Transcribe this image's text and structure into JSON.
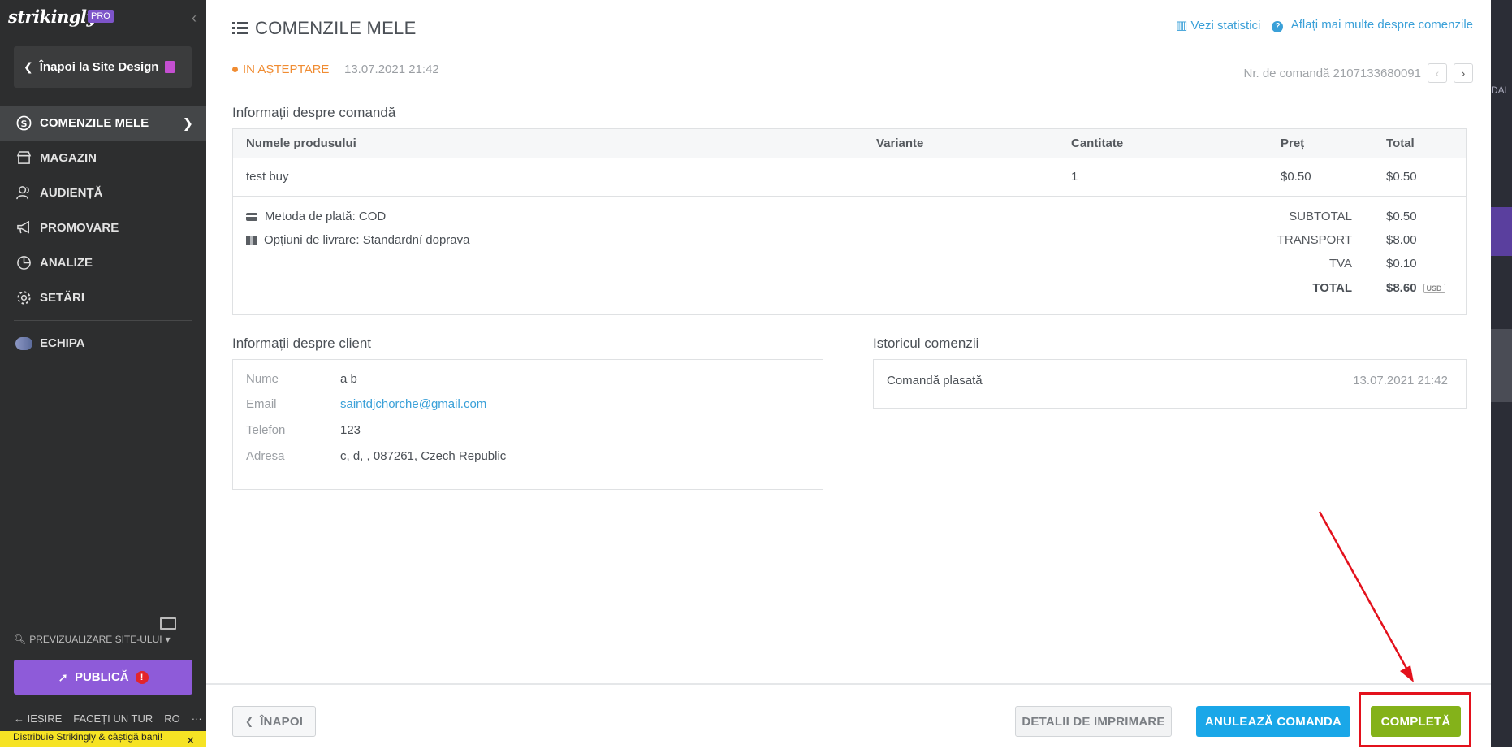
{
  "sidebar": {
    "logo": "strikingly",
    "badge": "PRO",
    "back_button": "Înapoi la Site Design",
    "items": [
      {
        "label": "COMENZILE MELE",
        "icon": "dollar-circle-icon"
      },
      {
        "label": "MAGAZIN",
        "icon": "store-icon"
      },
      {
        "label": "AUDIENȚĂ",
        "icon": "audience-icon"
      },
      {
        "label": "PROMOVARE",
        "icon": "megaphone-icon"
      },
      {
        "label": "ANALIZE",
        "icon": "pie-chart-icon"
      },
      {
        "label": "SETĂRI",
        "icon": "gear-icon"
      }
    ],
    "team": "ECHIPA",
    "preview": "PREVIZUALIZARE SITE-ULUI",
    "publish": "PUBLICĂ",
    "publish_alert": "!",
    "footer": {
      "exit": "IEȘIRE",
      "tour": "FACEȚI UN TUR",
      "lang": "RO",
      "more": "···"
    },
    "promo": "Distribuie Strikingly & câștigă bani!"
  },
  "header": {
    "title": "COMENZILE MELE",
    "stats_link": "Vezi statistici",
    "help_link": "Aflați mai multe despre comenzile",
    "status": "IN AȘTEPTARE",
    "date": "13.07.2021 21:42",
    "order_number": "Nr. de comandă 2107133680091"
  },
  "order": {
    "section_title": "Informații despre comandă",
    "columns": [
      "Numele produsului",
      "Variante",
      "Cantitate",
      "Preț",
      "Total"
    ],
    "rows": [
      {
        "name": "test buy",
        "variant": "",
        "qty": "1",
        "price": "$0.50",
        "total": "$0.50"
      }
    ],
    "payment": "Metoda de plată: COD",
    "shipping": "Opțiuni de livrare: Standardní doprava",
    "summary": {
      "subtotal_label": "SUBTOTAL",
      "subtotal": "$0.50",
      "transport_label": "TRANSPORT",
      "transport": "$8.00",
      "tax_label": "TVA",
      "tax": "$0.10",
      "total_label": "TOTAL",
      "total": "$8.60",
      "currency": "USD"
    }
  },
  "client": {
    "section_title": "Informații despre client",
    "fields": [
      {
        "label": "Nume",
        "value": "a b"
      },
      {
        "label": "Email",
        "value": "saintdjchorche@gmail.com"
      },
      {
        "label": "Telefon",
        "value": "123"
      },
      {
        "label": "Adresa",
        "value": "c, d, , 087261, Czech Republic"
      }
    ]
  },
  "history": {
    "section_title": "Istoricul comenzii",
    "event": "Comandă plasată",
    "date": "13.07.2021 21:42"
  },
  "actions": {
    "back": "ÎNAPOI",
    "print": "DETALII DE IMPRIMARE",
    "cancel": "ANULEAZĂ COMANDA",
    "complete": "COMPLETĂ"
  },
  "right_strip_text": "DAL",
  "colors": {
    "accent_blue": "#1aa7e8",
    "complete_green": "#84b21a",
    "publish_purple": "#8e5bd9",
    "pending_orange": "#f08c32",
    "highlight_red": "#e3111c"
  }
}
